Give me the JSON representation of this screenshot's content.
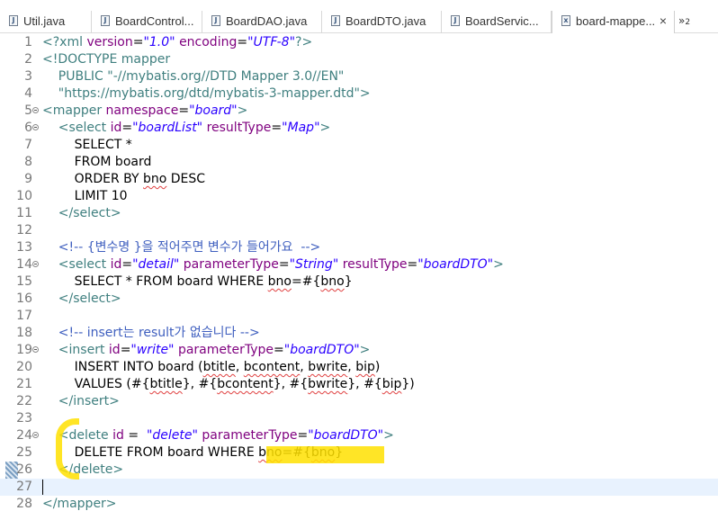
{
  "tabs": [
    {
      "label": "Util.java",
      "icon": "java-file-icon",
      "icon_glyph": "J"
    },
    {
      "label": "BoardControl...",
      "icon": "java-file-icon",
      "icon_glyph": "J"
    },
    {
      "label": "BoardDAO.java",
      "icon": "java-file-icon",
      "icon_glyph": "J"
    },
    {
      "label": "BoardDTO.java",
      "icon": "java-file-icon",
      "icon_glyph": "J"
    },
    {
      "label": "BoardServic...",
      "icon": "java-file-icon",
      "icon_glyph": "J"
    },
    {
      "label": "board-mappe...",
      "icon": "xml-file-icon",
      "icon_glyph": "x",
      "active": true
    }
  ],
  "active_tab_close": "×",
  "overflow": {
    "symbol": "»",
    "count": "2"
  },
  "colors": {
    "tag": "#3f7f7f",
    "attr": "#7f007f",
    "string": "#2a00ff",
    "comment": "#3f5fbf",
    "highlight": "#ffe100",
    "current_line": "#e8f2fe"
  },
  "editor": {
    "current_line": 27,
    "lines": [
      {
        "n": "1",
        "fold": false,
        "tokens": [
          [
            "tag",
            "<?xml "
          ],
          [
            "attr",
            "version"
          ],
          [
            "txt",
            "="
          ],
          [
            "str",
            "\"1.0\""
          ],
          [
            "txt",
            " "
          ],
          [
            "attr",
            "encoding"
          ],
          [
            "txt",
            "="
          ],
          [
            "str",
            "\"UTF-8\""
          ],
          [
            "tag",
            "?>"
          ]
        ]
      },
      {
        "n": "2",
        "fold": false,
        "tokens": [
          [
            "tag",
            "<!DOCTYPE mapper"
          ]
        ]
      },
      {
        "n": "3",
        "fold": false,
        "tokens": [
          [
            "tag",
            "    PUBLIC \"-//mybatis.org//DTD Mapper 3.0//EN\""
          ]
        ]
      },
      {
        "n": "4",
        "fold": false,
        "tokens": [
          [
            "tag",
            "    \"https://mybatis.org/dtd/mybatis-3-mapper.dtd\">"
          ]
        ]
      },
      {
        "n": "5",
        "fold": true,
        "tokens": [
          [
            "tag",
            "<mapper "
          ],
          [
            "attr",
            "namespace"
          ],
          [
            "txt",
            "="
          ],
          [
            "str",
            "\"board\""
          ],
          [
            "tag",
            ">"
          ]
        ]
      },
      {
        "n": "6",
        "fold": true,
        "tokens": [
          [
            "tag",
            "    <select "
          ],
          [
            "attr",
            "id"
          ],
          [
            "txt",
            "="
          ],
          [
            "str",
            "\"boardList\""
          ],
          [
            "txt",
            " "
          ],
          [
            "attr",
            "resultType"
          ],
          [
            "txt",
            "="
          ],
          [
            "str",
            "\"Map\""
          ],
          [
            "tag",
            ">"
          ]
        ]
      },
      {
        "n": "7",
        "fold": false,
        "tokens": [
          [
            "txt",
            "        SELECT *"
          ]
        ]
      },
      {
        "n": "8",
        "fold": false,
        "tokens": [
          [
            "txt",
            "        FROM board"
          ]
        ]
      },
      {
        "n": "9",
        "fold": false,
        "tokens": [
          [
            "txt",
            "        ORDER BY "
          ],
          [
            "sq",
            "bno"
          ],
          [
            "txt",
            " DESC"
          ]
        ]
      },
      {
        "n": "10",
        "fold": false,
        "tokens": [
          [
            "txt",
            "        LIMIT 10"
          ]
        ]
      },
      {
        "n": "11",
        "fold": false,
        "tokens": [
          [
            "tag",
            "    </select>"
          ]
        ]
      },
      {
        "n": "12",
        "fold": false,
        "tokens": []
      },
      {
        "n": "13",
        "fold": false,
        "tokens": [
          [
            "cmt",
            "    <!-- {변수명 }을 적어주면 변수가 들어가요  -->"
          ]
        ]
      },
      {
        "n": "14",
        "fold": true,
        "tokens": [
          [
            "tag",
            "    <select "
          ],
          [
            "attr",
            "id"
          ],
          [
            "txt",
            "="
          ],
          [
            "str",
            "\"detail\""
          ],
          [
            "txt",
            " "
          ],
          [
            "attr",
            "parameterType"
          ],
          [
            "txt",
            "="
          ],
          [
            "str",
            "\"String\""
          ],
          [
            "txt",
            " "
          ],
          [
            "attr",
            "resultType"
          ],
          [
            "txt",
            "="
          ],
          [
            "str",
            "\"boardDTO\""
          ],
          [
            "tag",
            ">"
          ]
        ]
      },
      {
        "n": "15",
        "fold": false,
        "tokens": [
          [
            "txt",
            "        SELECT * FROM board WHERE "
          ],
          [
            "sq",
            "bno"
          ],
          [
            "txt",
            "=#{"
          ],
          [
            "sq",
            "bno"
          ],
          [
            "txt",
            "}"
          ]
        ]
      },
      {
        "n": "16",
        "fold": false,
        "tokens": [
          [
            "tag",
            "    </select>"
          ]
        ]
      },
      {
        "n": "17",
        "fold": false,
        "tokens": []
      },
      {
        "n": "18",
        "fold": false,
        "tokens": [
          [
            "cmt",
            "    <!-- insert는 result가 없습니다 -->"
          ]
        ]
      },
      {
        "n": "19",
        "fold": true,
        "tokens": [
          [
            "tag",
            "    <insert "
          ],
          [
            "attr",
            "id"
          ],
          [
            "txt",
            "="
          ],
          [
            "str",
            "\"write\""
          ],
          [
            "txt",
            " "
          ],
          [
            "attr",
            "parameterType"
          ],
          [
            "txt",
            "="
          ],
          [
            "str",
            "\"boardDTO\""
          ],
          [
            "tag",
            ">"
          ]
        ]
      },
      {
        "n": "20",
        "fold": false,
        "tokens": [
          [
            "txt",
            "        INSERT INTO board ("
          ],
          [
            "sq",
            "btitle"
          ],
          [
            "txt",
            ", "
          ],
          [
            "sq",
            "bcontent"
          ],
          [
            "txt",
            ", "
          ],
          [
            "sq",
            "bwrite"
          ],
          [
            "txt",
            ", "
          ],
          [
            "sq",
            "bip"
          ],
          [
            "txt",
            ")"
          ]
        ]
      },
      {
        "n": "21",
        "fold": false,
        "tokens": [
          [
            "txt",
            "        VALUES (#{"
          ],
          [
            "sq",
            "btitle"
          ],
          [
            "txt",
            "}, #{"
          ],
          [
            "sq",
            "bcontent"
          ],
          [
            "txt",
            "}, #{"
          ],
          [
            "sq",
            "bwrite"
          ],
          [
            "txt",
            "}, #{"
          ],
          [
            "sq",
            "bip"
          ],
          [
            "txt",
            "})"
          ]
        ]
      },
      {
        "n": "22",
        "fold": false,
        "tokens": [
          [
            "tag",
            "    </insert>"
          ]
        ]
      },
      {
        "n": "23",
        "fold": false,
        "tokens": []
      },
      {
        "n": "24",
        "fold": true,
        "tokens": [
          [
            "tag",
            "    <delete "
          ],
          [
            "attr",
            "id"
          ],
          [
            "txt",
            " =  "
          ],
          [
            "str",
            "\"delete\""
          ],
          [
            "txt",
            " "
          ],
          [
            "attr",
            "parameterType"
          ],
          [
            "txt",
            "="
          ],
          [
            "str",
            "\"boardDTO\""
          ],
          [
            "tag",
            ">"
          ]
        ]
      },
      {
        "n": "25",
        "fold": false,
        "tokens": [
          [
            "txt",
            "        DELETE FROM board WHERE "
          ],
          [
            "sq",
            "bno"
          ],
          [
            "txt",
            "=#{"
          ],
          [
            "sq",
            "bno"
          ],
          [
            "txt",
            "}"
          ]
        ]
      },
      {
        "n": "26",
        "fold": false,
        "tokens": [
          [
            "tag",
            "    </delete>"
          ]
        ]
      },
      {
        "n": "27",
        "fold": false,
        "tokens": []
      },
      {
        "n": "28",
        "fold": false,
        "tokens": [
          [
            "tag",
            "</mapper>"
          ]
        ]
      }
    ]
  }
}
